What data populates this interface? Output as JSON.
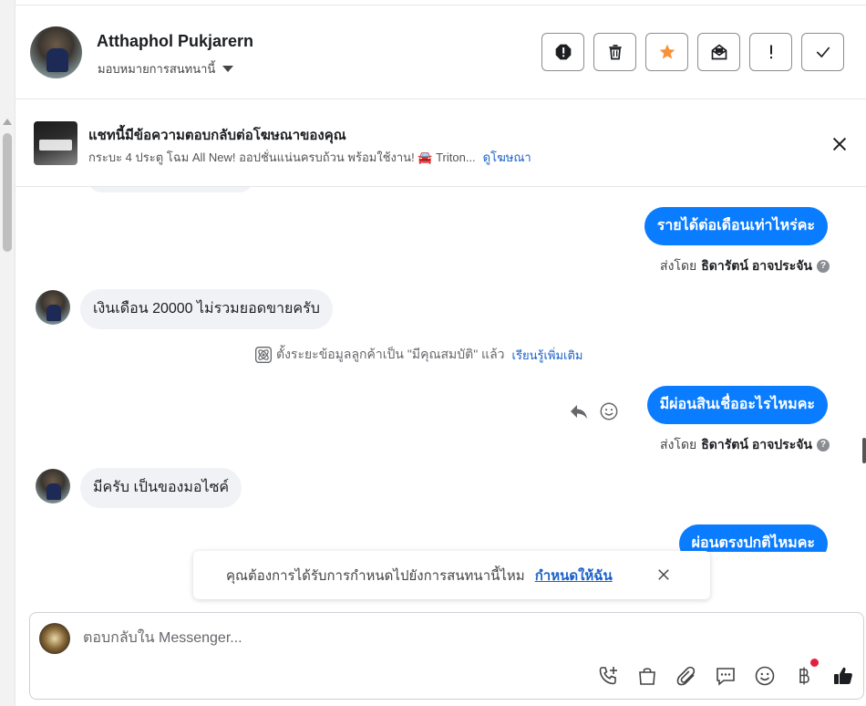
{
  "header": {
    "contact_name": "Atthaphol Pukjarern",
    "assign_label": "มอบหมายการสนทนานี้",
    "actions": [
      {
        "name": "spam-button",
        "icon": "alert-octagon-icon"
      },
      {
        "name": "delete-button",
        "icon": "trash-icon"
      },
      {
        "name": "star-button",
        "icon": "star-icon"
      },
      {
        "name": "mark-unread-button",
        "icon": "envelope-open-icon"
      },
      {
        "name": "follow-up-button",
        "icon": "exclamation-icon"
      },
      {
        "name": "mark-done-button",
        "icon": "check-icon"
      }
    ],
    "star_color": "#f7923a"
  },
  "ad_banner": {
    "title": "แชทนี้มีข้อความตอบกลับต่อโฆษณาของคุณ",
    "description": "กระบะ 4 ประตู โฉม All New! ออปชั่นแน่นครบถ้วน พร้อมใช้งาน! 🚘 Triton...",
    "link": "ดูโฆษณา"
  },
  "thread": {
    "messages": [
      {
        "direction": "out",
        "text": "รายได้ต่อเดือนเท่าไหร่คะ",
        "sent_by_label": "ส่งโดย",
        "sender": "ธิดารัตน์ อาจประจัน"
      },
      {
        "direction": "in",
        "text": "เงินเดือน  20000  ไม่รวมยอดขายครับ"
      },
      {
        "direction": "system",
        "text": "ตั้งระยะข้อมูลลูกค้าเป็น \"มีคุณสมบัติ\" แล้ว",
        "link": "เรียนรู้เพิ่มเติม"
      },
      {
        "direction": "out",
        "text": "มีผ่อนสินเชื่ออะไรไหมคะ",
        "sent_by_label": "ส่งโดย",
        "sender": "ธิดารัตน์ อาจประจัน"
      },
      {
        "direction": "in",
        "text": "มีครับ เป็นของมอไซค์"
      },
      {
        "direction": "out",
        "text": "ผ่อนตรงปกติไหมคะ"
      }
    ]
  },
  "assign_prompt": {
    "text": "คุณต้องการได้รับการกำหนดไปยังการสนทนานี้ไหม",
    "action": "กำหนดให้ฉัน"
  },
  "composer": {
    "placeholder": "ตอบกลับใน Messenger...",
    "tools": [
      "call-add-icon",
      "shopping-bag-icon",
      "paperclip-icon",
      "saved-reply-icon",
      "emoji-icon",
      "baht-payment-icon",
      "thumbs-up-icon"
    ]
  },
  "colors": {
    "outgoing_bubble": "#0a7cff",
    "incoming_bubble": "#f0f2f5",
    "link": "#1a61c9",
    "like_button": "#1c1e21",
    "notification": "#e41e3f"
  }
}
